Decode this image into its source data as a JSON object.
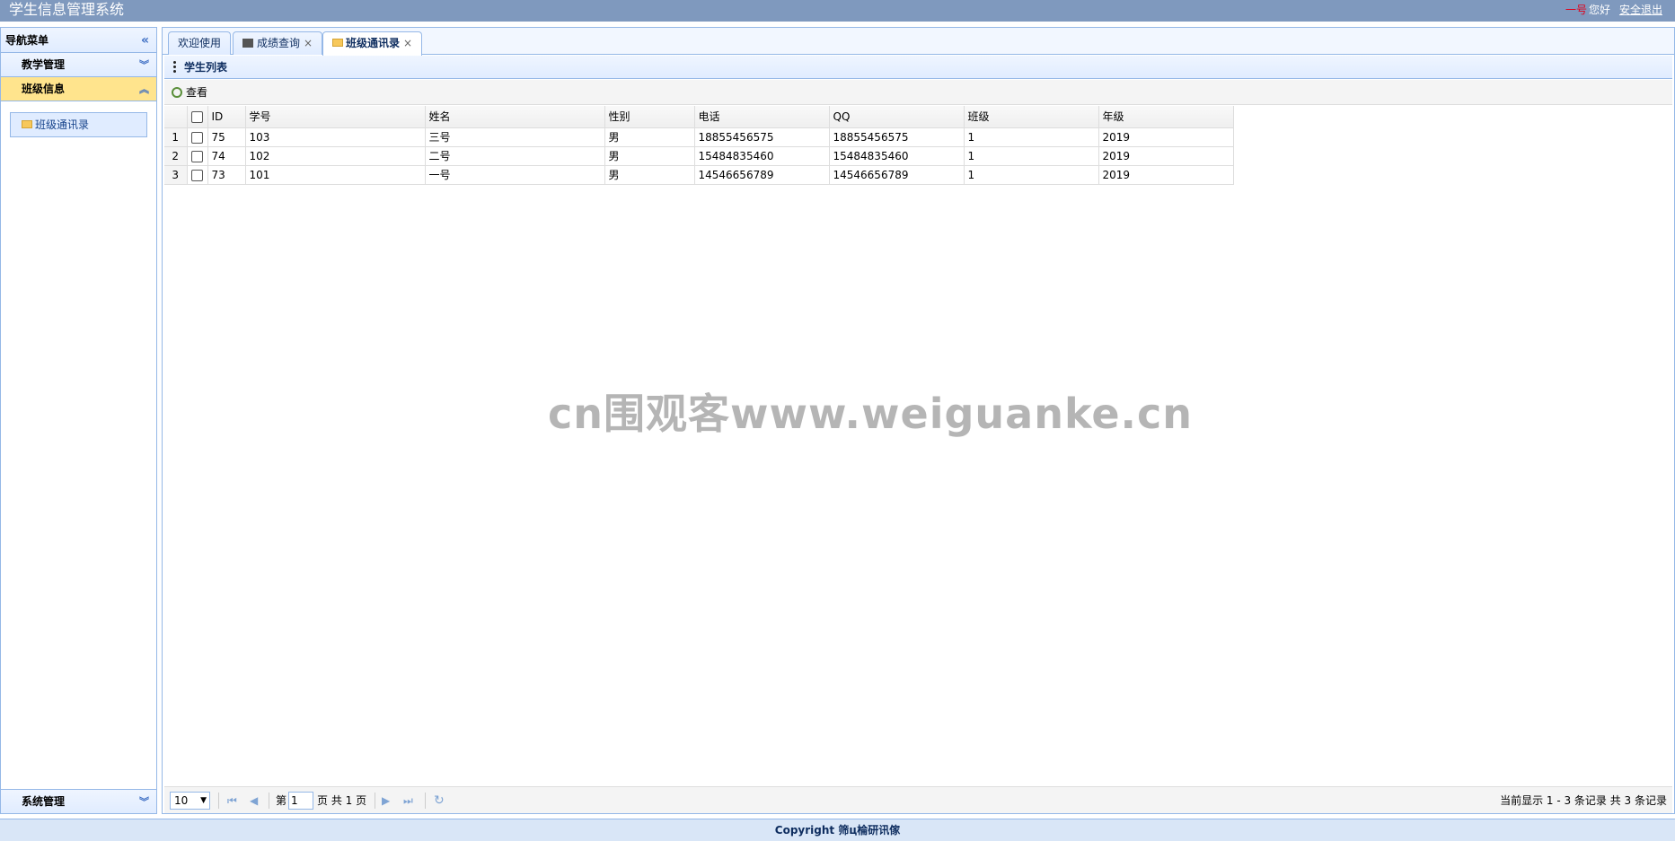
{
  "app": {
    "title": "学生信息管理系统",
    "user_name": "一号",
    "greeting": "您好",
    "logout_label": "安全退出"
  },
  "nav": {
    "header": "导航菜单",
    "sections": [
      {
        "label": "教学管理",
        "expanded": false
      },
      {
        "label": "班级信息",
        "expanded": true
      },
      {
        "label": "系统管理",
        "expanded": false
      }
    ],
    "tree_item": "班级通讯录"
  },
  "tabs": [
    {
      "label": "欢迎使用",
      "closable": false,
      "selected": false
    },
    {
      "label": "成绩查询",
      "closable": true,
      "selected": false
    },
    {
      "label": "班级通讯录",
      "closable": true,
      "selected": true
    }
  ],
  "tab_close_glyph": "×",
  "panel": {
    "title": "学生列表",
    "toolbar_view_label": "查看"
  },
  "grid": {
    "columns": [
      "ID",
      "学号",
      "姓名",
      "性别",
      "电话",
      "QQ",
      "班级",
      "年级"
    ],
    "rows": [
      {
        "rownum": "1",
        "id": "75",
        "no": "103",
        "name": "三号",
        "sex": "男",
        "phone": "18855456575",
        "qq": "18855456575",
        "cls": "1",
        "grade": "2019"
      },
      {
        "rownum": "2",
        "id": "74",
        "no": "102",
        "name": "二号",
        "sex": "男",
        "phone": "15484835460",
        "qq": "15484835460",
        "cls": "1",
        "grade": "2019"
      },
      {
        "rownum": "3",
        "id": "73",
        "no": "101",
        "name": "一号",
        "sex": "男",
        "phone": "14546656789",
        "qq": "14546656789",
        "cls": "1",
        "grade": "2019"
      }
    ]
  },
  "pager": {
    "page_size": "10",
    "page_prefix": "第",
    "page_value": "1",
    "page_suffix": "页 共 1 页",
    "info": "当前显示 1 - 3 条记录 共 3 条记录"
  },
  "footer": {
    "text": "Copyright  筛ц棆研讯傢"
  },
  "watermark": "cn围观客www.weiguanke.cn"
}
